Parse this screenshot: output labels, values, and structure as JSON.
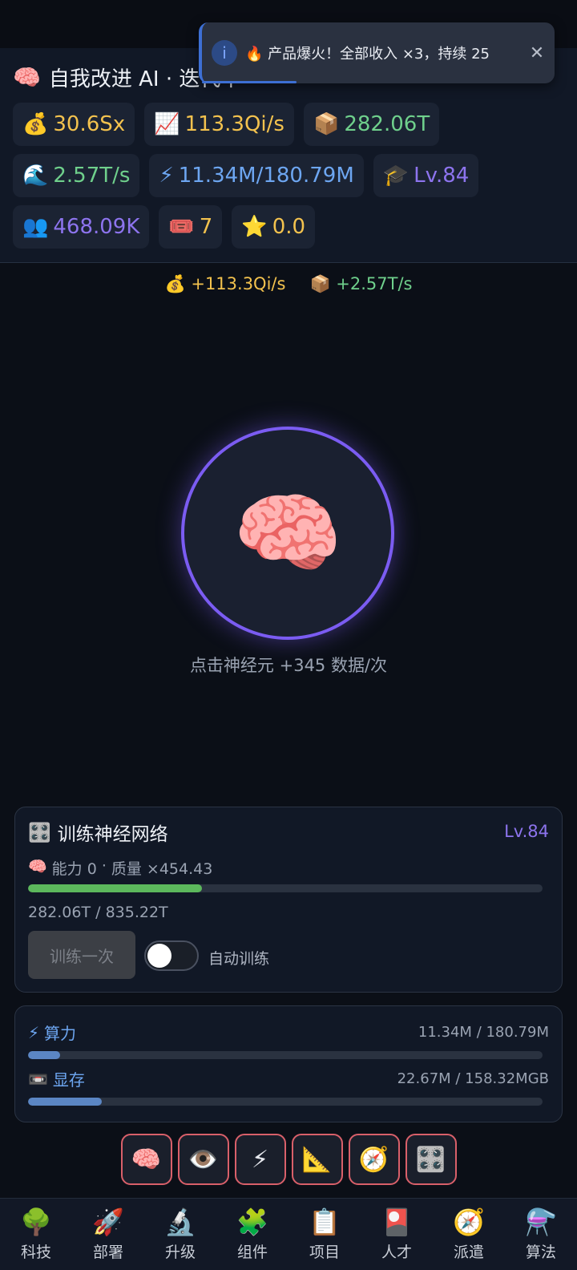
{
  "header": {
    "title_icon": "brain-icon",
    "title_emoji": "🧠",
    "title": "自我改进 AI · 迭代中"
  },
  "stats": {
    "money": {
      "icon": "💰",
      "value": "30.6Sx"
    },
    "income_rate": {
      "icon": "📈",
      "value": "113.3Qi/s"
    },
    "data": {
      "icon": "📦",
      "value": "282.06T"
    },
    "data_rate": {
      "icon": "🌊",
      "value": "2.57T/s"
    },
    "compute": {
      "icon": "⚡",
      "value": "11.34M/180.79M"
    },
    "level": {
      "icon": "🎓",
      "value": "Lv.84"
    },
    "users": {
      "icon": "👥",
      "value": "468.09K"
    },
    "tickets": {
      "icon": "🎟️",
      "value": "7"
    },
    "stars": {
      "icon": "⭐",
      "value": "0.0"
    }
  },
  "toast": {
    "icon": "i",
    "message": "🔥 产品爆火！全部收入 ×3，持续 25",
    "close": "✕"
  },
  "rates": {
    "money": {
      "icon": "💰",
      "text": "+113.3Qi/s"
    },
    "data": {
      "icon": "📦",
      "text": "+2.57T/s"
    }
  },
  "neuron": {
    "emoji": "🧠",
    "hint": "点击神经元 +345 数据/次"
  },
  "train": {
    "icon": "🎛️",
    "title": "训练神经网络",
    "level": "Lv.84",
    "sub_icon": "🧠",
    "ability": "能力 0",
    "separator": "·",
    "quality": "质量 ×454.43",
    "progress_fraction": 0.3377,
    "progress_text": "282.06T / 835.22T",
    "button": "训练一次",
    "auto_label": "自动训练",
    "auto_enabled": false,
    "colors": {
      "progress": "#5cb85c"
    }
  },
  "resources": {
    "compute": {
      "icon": "⚡",
      "label": "算力",
      "value": "11.34M / 180.79M",
      "fraction": 0.0627
    },
    "memory": {
      "icon": "📼",
      "label": "显存",
      "value": "22.67M / 158.32MGB",
      "fraction": 0.1432
    },
    "colors": {
      "fill": "#5b86c4"
    }
  },
  "quick_buttons": [
    {
      "name": "brain",
      "emoji": "🧠"
    },
    {
      "name": "eye",
      "emoji": "👁️"
    },
    {
      "name": "lightning",
      "emoji": "⚡"
    },
    {
      "name": "ruler",
      "emoji": "📐"
    },
    {
      "name": "compass",
      "emoji": "🧭"
    },
    {
      "name": "control-knobs",
      "emoji": "🎛️"
    }
  ],
  "nav": [
    {
      "name": "tech",
      "emoji": "🌳",
      "label": "科技"
    },
    {
      "name": "deploy",
      "emoji": "🚀",
      "label": "部署"
    },
    {
      "name": "upgrade",
      "emoji": "🔬",
      "label": "升级"
    },
    {
      "name": "components",
      "emoji": "🧩",
      "label": "组件"
    },
    {
      "name": "projects",
      "emoji": "📋",
      "label": "项目"
    },
    {
      "name": "talent",
      "emoji": "🎴",
      "label": "人才"
    },
    {
      "name": "dispatch",
      "emoji": "🧭",
      "label": "派遣"
    },
    {
      "name": "algorithm",
      "emoji": "⚗️",
      "label": "算法"
    }
  ]
}
